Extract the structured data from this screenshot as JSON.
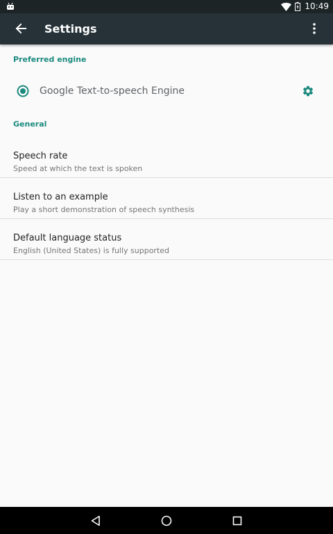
{
  "status_bar": {
    "time": "10:49",
    "icons": [
      "android-icon",
      "wifi-icon",
      "battery-icon"
    ]
  },
  "toolbar": {
    "title": "Settings",
    "back_icon": "arrow-back-icon",
    "overflow_icon": "more-vert-icon"
  },
  "preferred_engine": {
    "header": "Preferred engine",
    "engine_name": "Google Text-to-speech Engine",
    "selected": true,
    "settings_icon": "gear-icon"
  },
  "general": {
    "header": "General",
    "items": [
      {
        "title": "Speech rate",
        "summary": "Speed at which the text is spoken"
      },
      {
        "title": "Listen to an example",
        "summary": "Play a short demonstration of speech synthesis"
      },
      {
        "title": "Default language status",
        "summary": "English (United States) is fully supported"
      }
    ]
  },
  "nav_bar": {
    "icons": [
      "back-triangle-icon",
      "home-circle-icon",
      "recents-square-icon"
    ]
  },
  "colors": {
    "accent": "#1b8a7e",
    "toolbar": "#263238",
    "status_bar": "#1d2426",
    "background": "#fafafa"
  }
}
